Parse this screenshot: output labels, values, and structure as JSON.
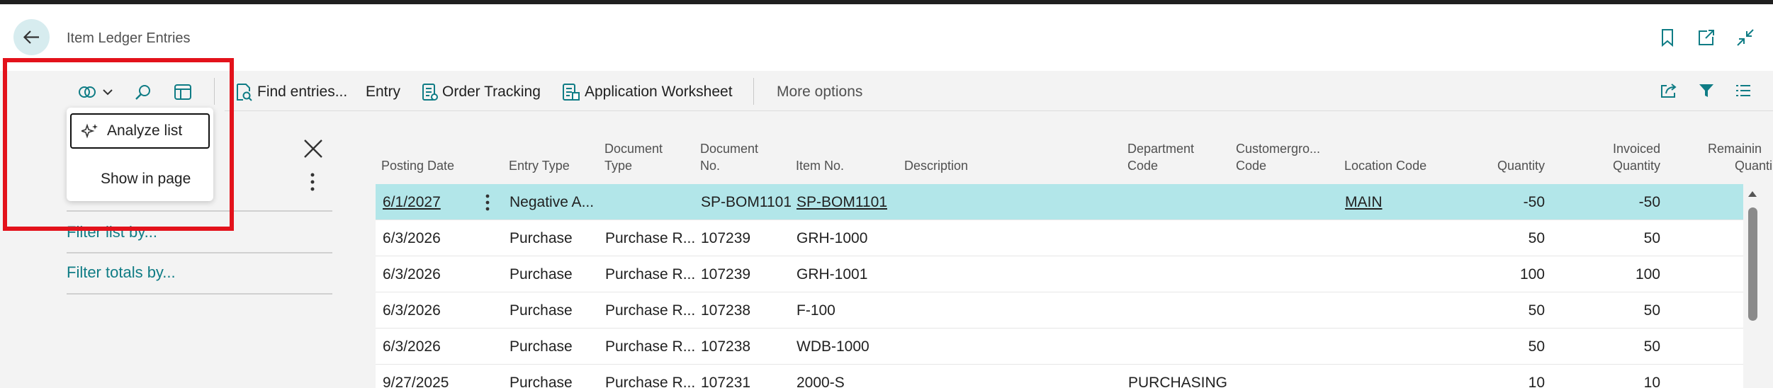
{
  "page": {
    "title": "Item Ledger Entries"
  },
  "toolbar": {
    "find_entries": "Find entries...",
    "entry": "Entry",
    "order_tracking": "Order Tracking",
    "application_worksheet": "Application Worksheet",
    "more_options": "More options"
  },
  "dropdown": {
    "analyze_list": "Analyze list",
    "show_in_page": "Show in page"
  },
  "filter_pane": {
    "filter_list_by": "Filter list by...",
    "filter_totals_by": "Filter totals by..."
  },
  "columns": {
    "posting_date": "Posting Date",
    "entry_type": "Entry Type",
    "document_type_1": "Document",
    "document_type_2": "Type",
    "document_no_1": "Document",
    "document_no_2": "No.",
    "item_no": "Item No.",
    "description": "Description",
    "department_code_1": "Department",
    "department_code_2": "Code",
    "customergroup_code_1": "Customergro...",
    "customergroup_code_2": "Code",
    "location_code": "Location Code",
    "quantity": "Quantity",
    "invoiced_quantity_1": "Invoiced",
    "invoiced_quantity_2": "Quantity",
    "remaining_quantity_1": "Remainin",
    "remaining_quantity_2": "Quanti"
  },
  "rows": [
    {
      "posting_date": "6/1/2027",
      "entry_type": "Negative A...",
      "document_type": "",
      "document_no": "SP-BOM1101",
      "item_no": "SP-BOM1101",
      "department_code": "",
      "location_code": "MAIN",
      "quantity": "-50",
      "invoiced_quantity": "-50"
    },
    {
      "posting_date": "6/3/2026",
      "entry_type": "Purchase",
      "document_type": "Purchase R...",
      "document_no": "107239",
      "item_no": "GRH-1000",
      "department_code": "",
      "location_code": "",
      "quantity": "50",
      "invoiced_quantity": "50"
    },
    {
      "posting_date": "6/3/2026",
      "entry_type": "Purchase",
      "document_type": "Purchase R...",
      "document_no": "107239",
      "item_no": "GRH-1001",
      "department_code": "",
      "location_code": "",
      "quantity": "100",
      "invoiced_quantity": "100"
    },
    {
      "posting_date": "6/3/2026",
      "entry_type": "Purchase",
      "document_type": "Purchase R...",
      "document_no": "107238",
      "item_no": "F-100",
      "department_code": "",
      "location_code": "",
      "quantity": "50",
      "invoiced_quantity": "50"
    },
    {
      "posting_date": "6/3/2026",
      "entry_type": "Purchase",
      "document_type": "Purchase R...",
      "document_no": "107238",
      "item_no": "WDB-1000",
      "department_code": "",
      "location_code": "",
      "quantity": "50",
      "invoiced_quantity": "50"
    },
    {
      "posting_date": "9/27/2025",
      "entry_type": "Purchase",
      "document_type": "Purchase R...",
      "document_no": "107231",
      "item_no": "2000-S",
      "department_code": "PURCHASING",
      "location_code": "",
      "quantity": "10",
      "invoiced_quantity": "10"
    }
  ],
  "colors": {
    "accent": "#0f7c85",
    "selected_row": "#b2e6e9",
    "highlight_box": "#e3121b"
  },
  "icons": [
    "back-arrow-icon",
    "bookmark-icon",
    "open-new-window-icon",
    "collapse-icon",
    "analyze-icon",
    "chevron-down-icon",
    "search-icon",
    "filter-pane-icon",
    "find-entries-icon",
    "order-tracking-icon",
    "application-worksheet-icon",
    "share-icon",
    "filter-icon",
    "list-view-icon",
    "sparkle-icon",
    "close-icon",
    "more-options-icon"
  ]
}
